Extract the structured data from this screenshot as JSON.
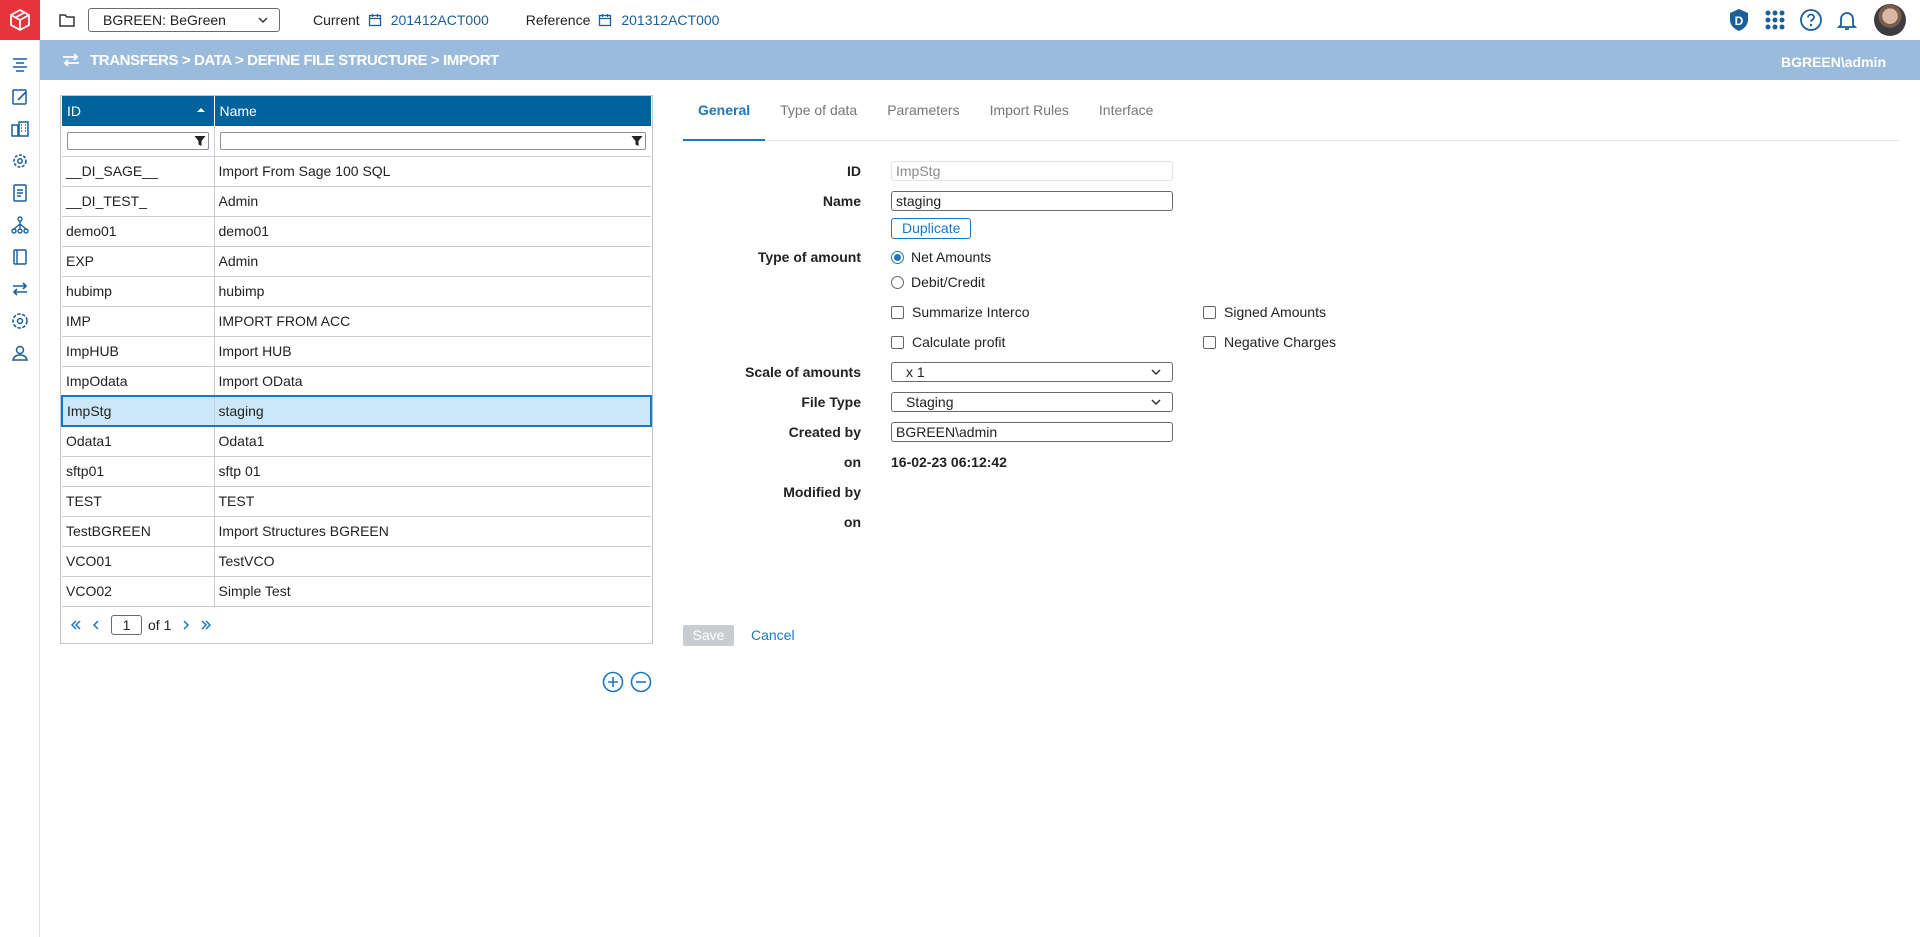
{
  "topbar": {
    "company": "BGREEN: BeGreen",
    "current_label": "Current",
    "current_value": "201412ACT000",
    "reference_label": "Reference",
    "reference_value": "201312ACT000",
    "badge_letter": "D"
  },
  "banner": {
    "breadcrumb": "TRANSFERS > DATA > DEFINE FILE STRUCTURE > IMPORT",
    "user": "BGREEN\\admin"
  },
  "grid": {
    "col_id": "ID",
    "col_name": "Name",
    "rows": [
      {
        "id": "__DI_SAGE__",
        "name": "Import From Sage 100 SQL"
      },
      {
        "id": "__DI_TEST_",
        "name": "Admin"
      },
      {
        "id": "demo01",
        "name": "demo01"
      },
      {
        "id": "EXP",
        "name": "Admin"
      },
      {
        "id": "hubimp",
        "name": "hubimp"
      },
      {
        "id": "IMP",
        "name": "IMPORT FROM ACC"
      },
      {
        "id": "ImpHUB",
        "name": "Import HUB"
      },
      {
        "id": "ImpOdata",
        "name": "Import OData"
      },
      {
        "id": "ImpStg",
        "name": "staging"
      },
      {
        "id": "Odata1",
        "name": "Odata1"
      },
      {
        "id": "sftp01",
        "name": "sftp 01"
      },
      {
        "id": "TEST",
        "name": "TEST"
      },
      {
        "id": "TestBGREEN",
        "name": "Import Structures BGREEN"
      },
      {
        "id": "VCO01",
        "name": "TestVCO"
      },
      {
        "id": "VCO02",
        "name": "Simple Test"
      }
    ],
    "pager": {
      "page": "1",
      "of_label": "of",
      "total": "1"
    }
  },
  "tabs": [
    "General",
    "Type of data",
    "Parameters",
    "Import Rules",
    "Interface"
  ],
  "form": {
    "id_label": "ID",
    "id_value": "ImpStg",
    "name_label": "Name",
    "name_value": "staging",
    "duplicate": "Duplicate",
    "type_label": "Type of amount",
    "net": "Net Amounts",
    "debit": "Debit/Credit",
    "summarize": "Summarize Interco",
    "signed": "Signed Amounts",
    "calc_profit": "Calculate profit",
    "negative": "Negative Charges",
    "scale_label": "Scale of amounts",
    "scale_value": "x 1",
    "filetype_label": "File Type",
    "filetype_value": "Staging",
    "created_label": "Created by",
    "created_value": "BGREEN\\admin",
    "on_label": "on",
    "created_on": "16-02-23 06:12:42",
    "modified_label": "Modified by",
    "modified_on_label": "on",
    "save": "Save",
    "cancel": "Cancel"
  }
}
